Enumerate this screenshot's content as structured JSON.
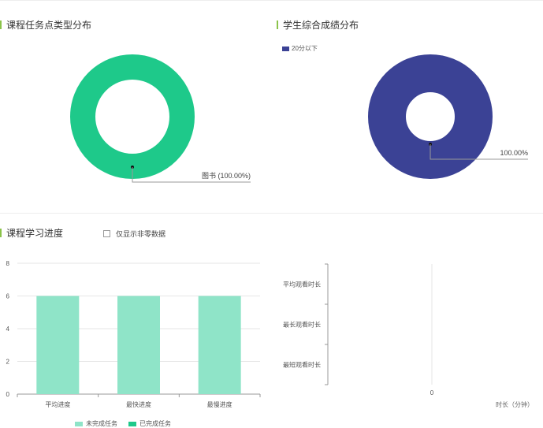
{
  "colors": {
    "accent_bar": "#8bc34a",
    "teal": "#1ec98a",
    "navy": "#3b4295",
    "light_teal": "#8fe4c8"
  },
  "sections": {
    "task_type": {
      "title": "课程任务点类型分布"
    },
    "score": {
      "title": "学生综合成绩分布",
      "legend_label": "20分以下"
    },
    "progress": {
      "title": "课程学习进度",
      "checkbox_label": "仅显示非零数据"
    }
  },
  "chart_data": [
    {
      "type": "pie",
      "title": "课程任务点类型分布",
      "slices": [
        {
          "label": "图书",
          "value": 100.0,
          "display": "图书 (100.00%)",
          "color": "#1ec98a"
        }
      ]
    },
    {
      "type": "pie",
      "title": "学生综合成绩分布",
      "legend": [
        "20分以下"
      ],
      "slices": [
        {
          "label": "20分以下",
          "value": 100.0,
          "display": "100.00%",
          "color": "#3b4295"
        }
      ]
    },
    {
      "type": "bar",
      "title": "课程学习进度",
      "categories": [
        "平均进度",
        "最快进度",
        "最慢进度"
      ],
      "values": [
        6,
        6,
        6
      ],
      "ylim": [
        0,
        8
      ],
      "yticks": [
        "0",
        "2",
        "4",
        "6",
        "8"
      ],
      "bar_color": "#8fe4c8",
      "legend": [
        {
          "label": "未完成任务",
          "color": "#8fe4c8"
        },
        {
          "label": "已完成任务",
          "color": "#1ec98a"
        }
      ]
    },
    {
      "type": "bar",
      "orientation": "horizontal",
      "categories": [
        "平均观看时长",
        "最长观看时长",
        "最短观看时长"
      ],
      "values": [
        0,
        0,
        0
      ],
      "xticks": [
        "0"
      ],
      "xlabel": "时长（分钟）"
    }
  ]
}
